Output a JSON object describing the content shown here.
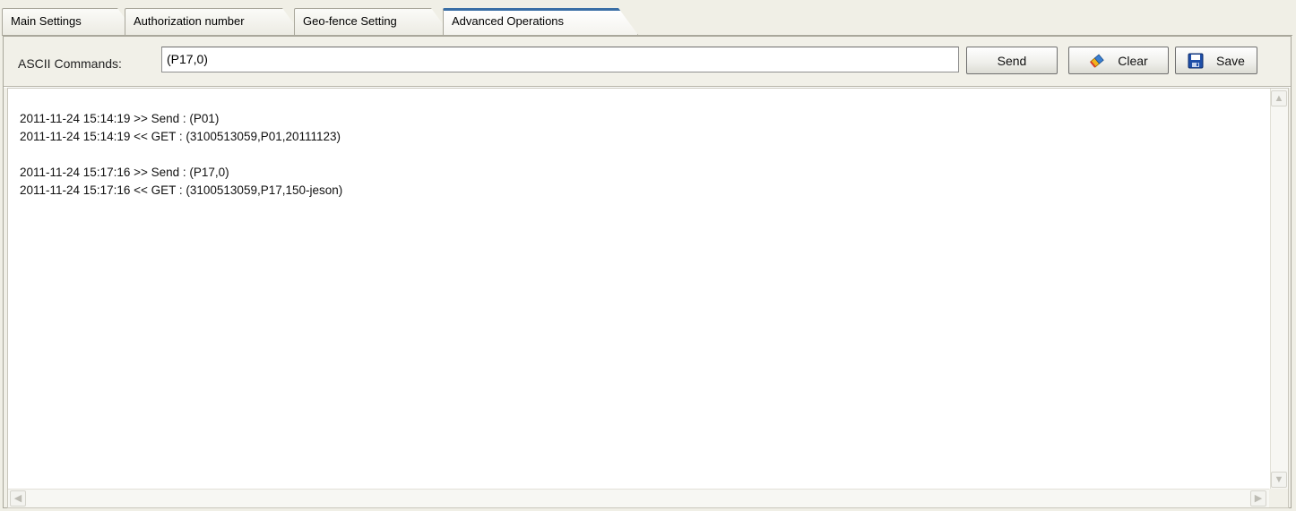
{
  "tabs": [
    {
      "label": "Main Settings"
    },
    {
      "label": "Authorization number"
    },
    {
      "label": "Geo-fence Setting"
    },
    {
      "label": "Advanced Operations"
    }
  ],
  "active_tab_index": 3,
  "command": {
    "label": "ASCII Commands:",
    "value": "(P17,0)"
  },
  "buttons": {
    "send": "Send",
    "clear": "Clear",
    "save": "Save"
  },
  "icons": {
    "clear": "eraser-icon",
    "save": "floppy-disk-icon"
  },
  "log": {
    "lines": [
      "2011-11-24 15:14:19 >> Send : (P01)",
      "2011-11-24 15:14:19 << GET : (3100513059,P01,20111123)",
      "",
      "2011-11-24 15:17:16 >> Send : (P17,0)",
      "2011-11-24 15:17:16 << GET : (3100513059,P17,150-jeson)"
    ]
  },
  "scroll_arrows": {
    "up": "▲",
    "down": "▼",
    "left": "◀",
    "right": "▶"
  },
  "colors": {
    "active_tab_accent": "#3a6ea5",
    "window_bg": "#f0efe6"
  }
}
